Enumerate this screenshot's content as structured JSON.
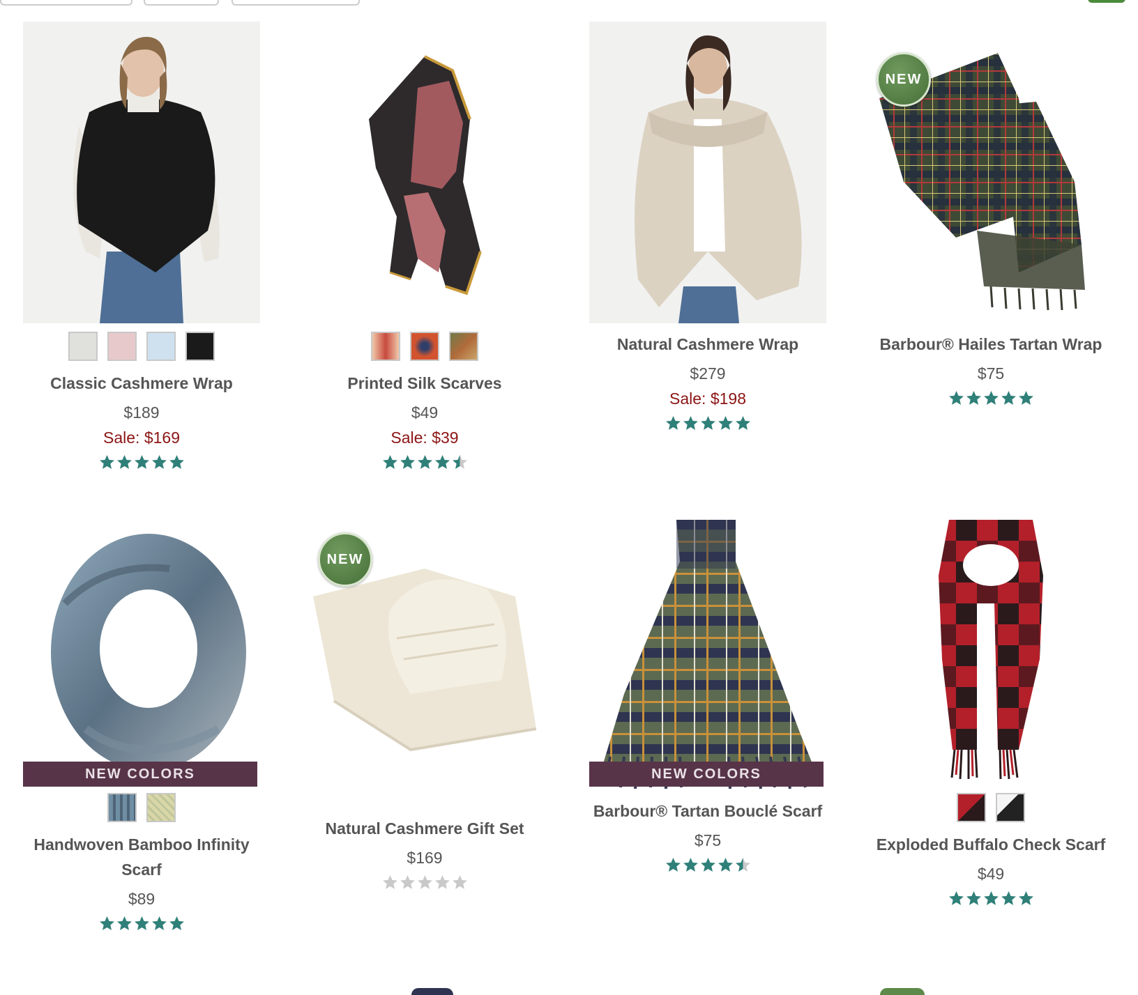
{
  "colors": {
    "name_text": "#555555",
    "sale_text": "#8c1515",
    "star_filled": "#2f8079",
    "star_empty": "#c9c9c9",
    "new_badge": "#4f7a3f",
    "new_colors_banner": "#583449"
  },
  "products": [
    {
      "name": "Classic Cashmere Wrap",
      "price": "$189",
      "sale": "Sale: $169",
      "rating": 5,
      "image": "woman-in-black-cashmere-wrap",
      "swatches": [
        "#e0e0dc",
        "#e8c9cb",
        "#cfe1ef",
        "#1a1a1a"
      ]
    },
    {
      "name": "Printed Silk Scarves",
      "price": "$49",
      "sale": "Sale: $39",
      "rating": 4.5,
      "image": "printed-silk-scarf-knotted",
      "swatches": [
        "#d96b4e",
        "#d2542f",
        "#b06a3a"
      ]
    },
    {
      "name": "Natural Cashmere Wrap",
      "price": "$279",
      "sale": "Sale: $198",
      "rating": 5,
      "image": "woman-in-natural-cashmere-wrap"
    },
    {
      "name": "Barbour® Hailes Tartan Wrap",
      "price": "$75",
      "rating": 5,
      "image": "green-tartan-wrap",
      "badge": "NEW"
    },
    {
      "name": "Handwoven Bamboo Infinity Scarf",
      "price": "$89",
      "rating": 5,
      "image": "blue-grey-infinity-scarf",
      "banner": "NEW COLORS",
      "swatches": [
        "#6f8ea3",
        "#d9d7a8"
      ]
    },
    {
      "name": "Natural Cashmere Gift Set",
      "price": "$169",
      "rating": 0,
      "image": "cream-cashmere-hat-and-scarf",
      "badge": "NEW"
    },
    {
      "name": "Barbour® Tartan Bouclé Scarf",
      "price": "$75",
      "rating": 4.5,
      "image": "tartan-boucle-scarf",
      "banner": "NEW COLORS"
    },
    {
      "name": "Exploded Buffalo Check Scarf",
      "price": "$49",
      "rating": 5,
      "image": "red-black-buffalo-check-scarf",
      "swatches": [
        "#7a1b22",
        "#2a2a2a"
      ]
    }
  ]
}
